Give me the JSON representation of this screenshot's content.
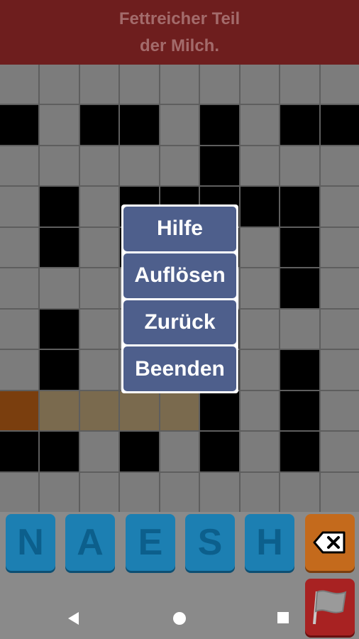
{
  "clue": {
    "line1": "Fettreicher Teil",
    "line2": "der Milch."
  },
  "grid": {
    "cols": 9,
    "rows": 11,
    "cells": [
      "_________",
      "b_bb_b_bb",
      "_____b___",
      "_b_bbbbb_",
      "_b_bbb_b_",
      "_______b_",
      "_b___b___",
      "_b___b_b_",
      "ottttb_b_",
      "bb_b_b_b_",
      "_________"
    ]
  },
  "menu": {
    "help": "Hilfe",
    "solve": "Auflösen",
    "back": "Zurück",
    "quit": "Beenden"
  },
  "letters": [
    "N",
    "A",
    "E",
    "S",
    "H"
  ],
  "icons": {
    "delete": "backspace-icon",
    "flag": "flag-icon",
    "nav_back": "nav-back-icon",
    "nav_home": "nav-home-icon",
    "nav_recent": "nav-recent-icon"
  }
}
